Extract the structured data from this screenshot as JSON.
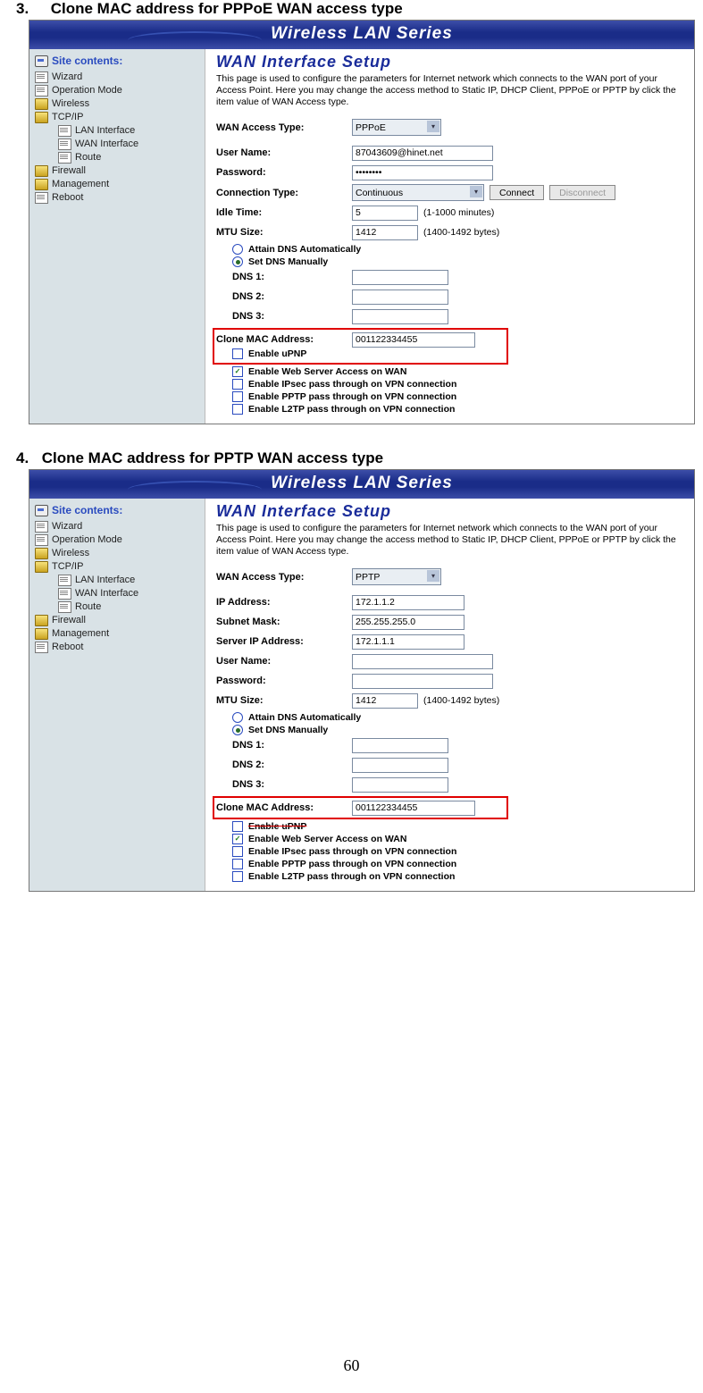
{
  "doc": {
    "headings": {
      "h3_num": "3.",
      "h3_text": "Clone MAC address for PPPoE WAN access type",
      "h4_num": "4.",
      "h4_text": "Clone MAC address for PPTP WAN access type"
    },
    "pagenum": "60"
  },
  "common": {
    "banner": "Wireless LAN Series",
    "site_contents_label": "Site contents:",
    "tree": {
      "wizard": "Wizard",
      "opmode": "Operation Mode",
      "wireless": "Wireless",
      "tcpip": "TCP/IP",
      "lan": "LAN Interface",
      "wan": "WAN Interface",
      "route": "Route",
      "firewall": "Firewall",
      "management": "Management",
      "reboot": "Reboot"
    },
    "content_title": "WAN Interface Setup",
    "content_desc": "This page is used to configure the parameters for Internet network which connects to the WAN port of your Access Point. Here you may change the access method to Static IP, DHCP Client, PPPoE or PPTP by click the item value of WAN Access type.",
    "labels": {
      "wan_access_type": "WAN Access Type:",
      "user_name": "User Name:",
      "password": "Password:",
      "connection_type": "Connection Type:",
      "idle_time": "Idle Time:",
      "mtu_size": "MTU Size:",
      "dns1": "DNS 1:",
      "dns2": "DNS 2:",
      "dns3": "DNS 3:",
      "clone_mac": "Clone MAC Address:",
      "ip_address": "IP Address:",
      "subnet_mask": "Subnet Mask:",
      "server_ip": "Server IP Address:"
    },
    "radios": {
      "attain_dns": "Attain DNS Automatically",
      "set_dns": "Set DNS Manually"
    },
    "checkboxes": {
      "upnp": "Enable uPNP",
      "webserver": "Enable Web Server Access on WAN",
      "ipsec": "Enable IPsec pass through on VPN connection",
      "pptp": "Enable PPTP pass through on VPN connection",
      "l2tp": "Enable L2TP pass through on VPN connection"
    },
    "buttons": {
      "connect": "Connect",
      "disconnect": "Disconnect"
    },
    "hints": {
      "idle": "(1-1000 minutes)",
      "mtu": "(1400-1492 bytes)"
    }
  },
  "shot1": {
    "values": {
      "wan_type": "PPPoE",
      "user": "87043609@hinet.net",
      "pass": "••••••••",
      "conn_type": "Continuous",
      "idle": "5",
      "mtu": "1412",
      "clone_mac": "001122334455"
    }
  },
  "shot2": {
    "values": {
      "wan_type": "PPTP",
      "ip": "172.1.1.2",
      "mask": "255.255.255.0",
      "server": "172.1.1.1",
      "user": "",
      "pass": "",
      "mtu": "1412",
      "clone_mac": "001122334455"
    }
  }
}
